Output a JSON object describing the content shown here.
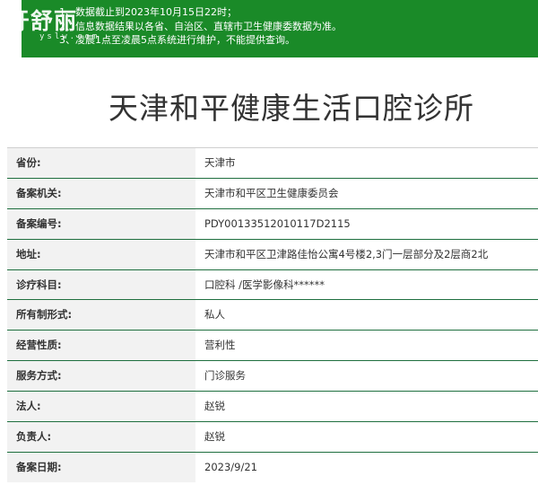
{
  "notice": {
    "lines": [
      "1、数据截止到2023年10月15日22时；",
      "2、信息数据结果以各省、自治区、直辖市卫生健康委数据为准。",
      "3、凌晨1点至凌晨5点系统进行维护，不能提供查询。"
    ],
    "background_color": "#1a8a28"
  },
  "watermark": {
    "main": "牙舒丽",
    "sub": "yslw.com"
  },
  "page_title": "天津和平健康生活口腔诊所",
  "records": [
    {
      "label": "省份:",
      "value": "天津市"
    },
    {
      "label": "备案机关:",
      "value": "天津市和平区卫生健康委员会"
    },
    {
      "label": "备案编号:",
      "value": "PDY00133512010117D2115"
    },
    {
      "label": "地址:",
      "value": "天津市和平区卫津路佳怡公寓4号楼2,3门一层部分及2层商2北"
    },
    {
      "label": "诊疗科目:",
      "value": "口腔科 /医学影像科******"
    },
    {
      "label": "所有制形式:",
      "value": "私人"
    },
    {
      "label": "经营性质:",
      "value": "营利性"
    },
    {
      "label": "服务方式:",
      "value": "门诊服务"
    },
    {
      "label": "法人:",
      "value": "赵锐"
    },
    {
      "label": "负责人:",
      "value": "赵锐"
    },
    {
      "label": "备案日期:",
      "value": "2023/9/21"
    }
  ],
  "colors": {
    "row_separator": "#1f6f3f",
    "label_background": "#f2f2f2",
    "text": "#333333"
  }
}
